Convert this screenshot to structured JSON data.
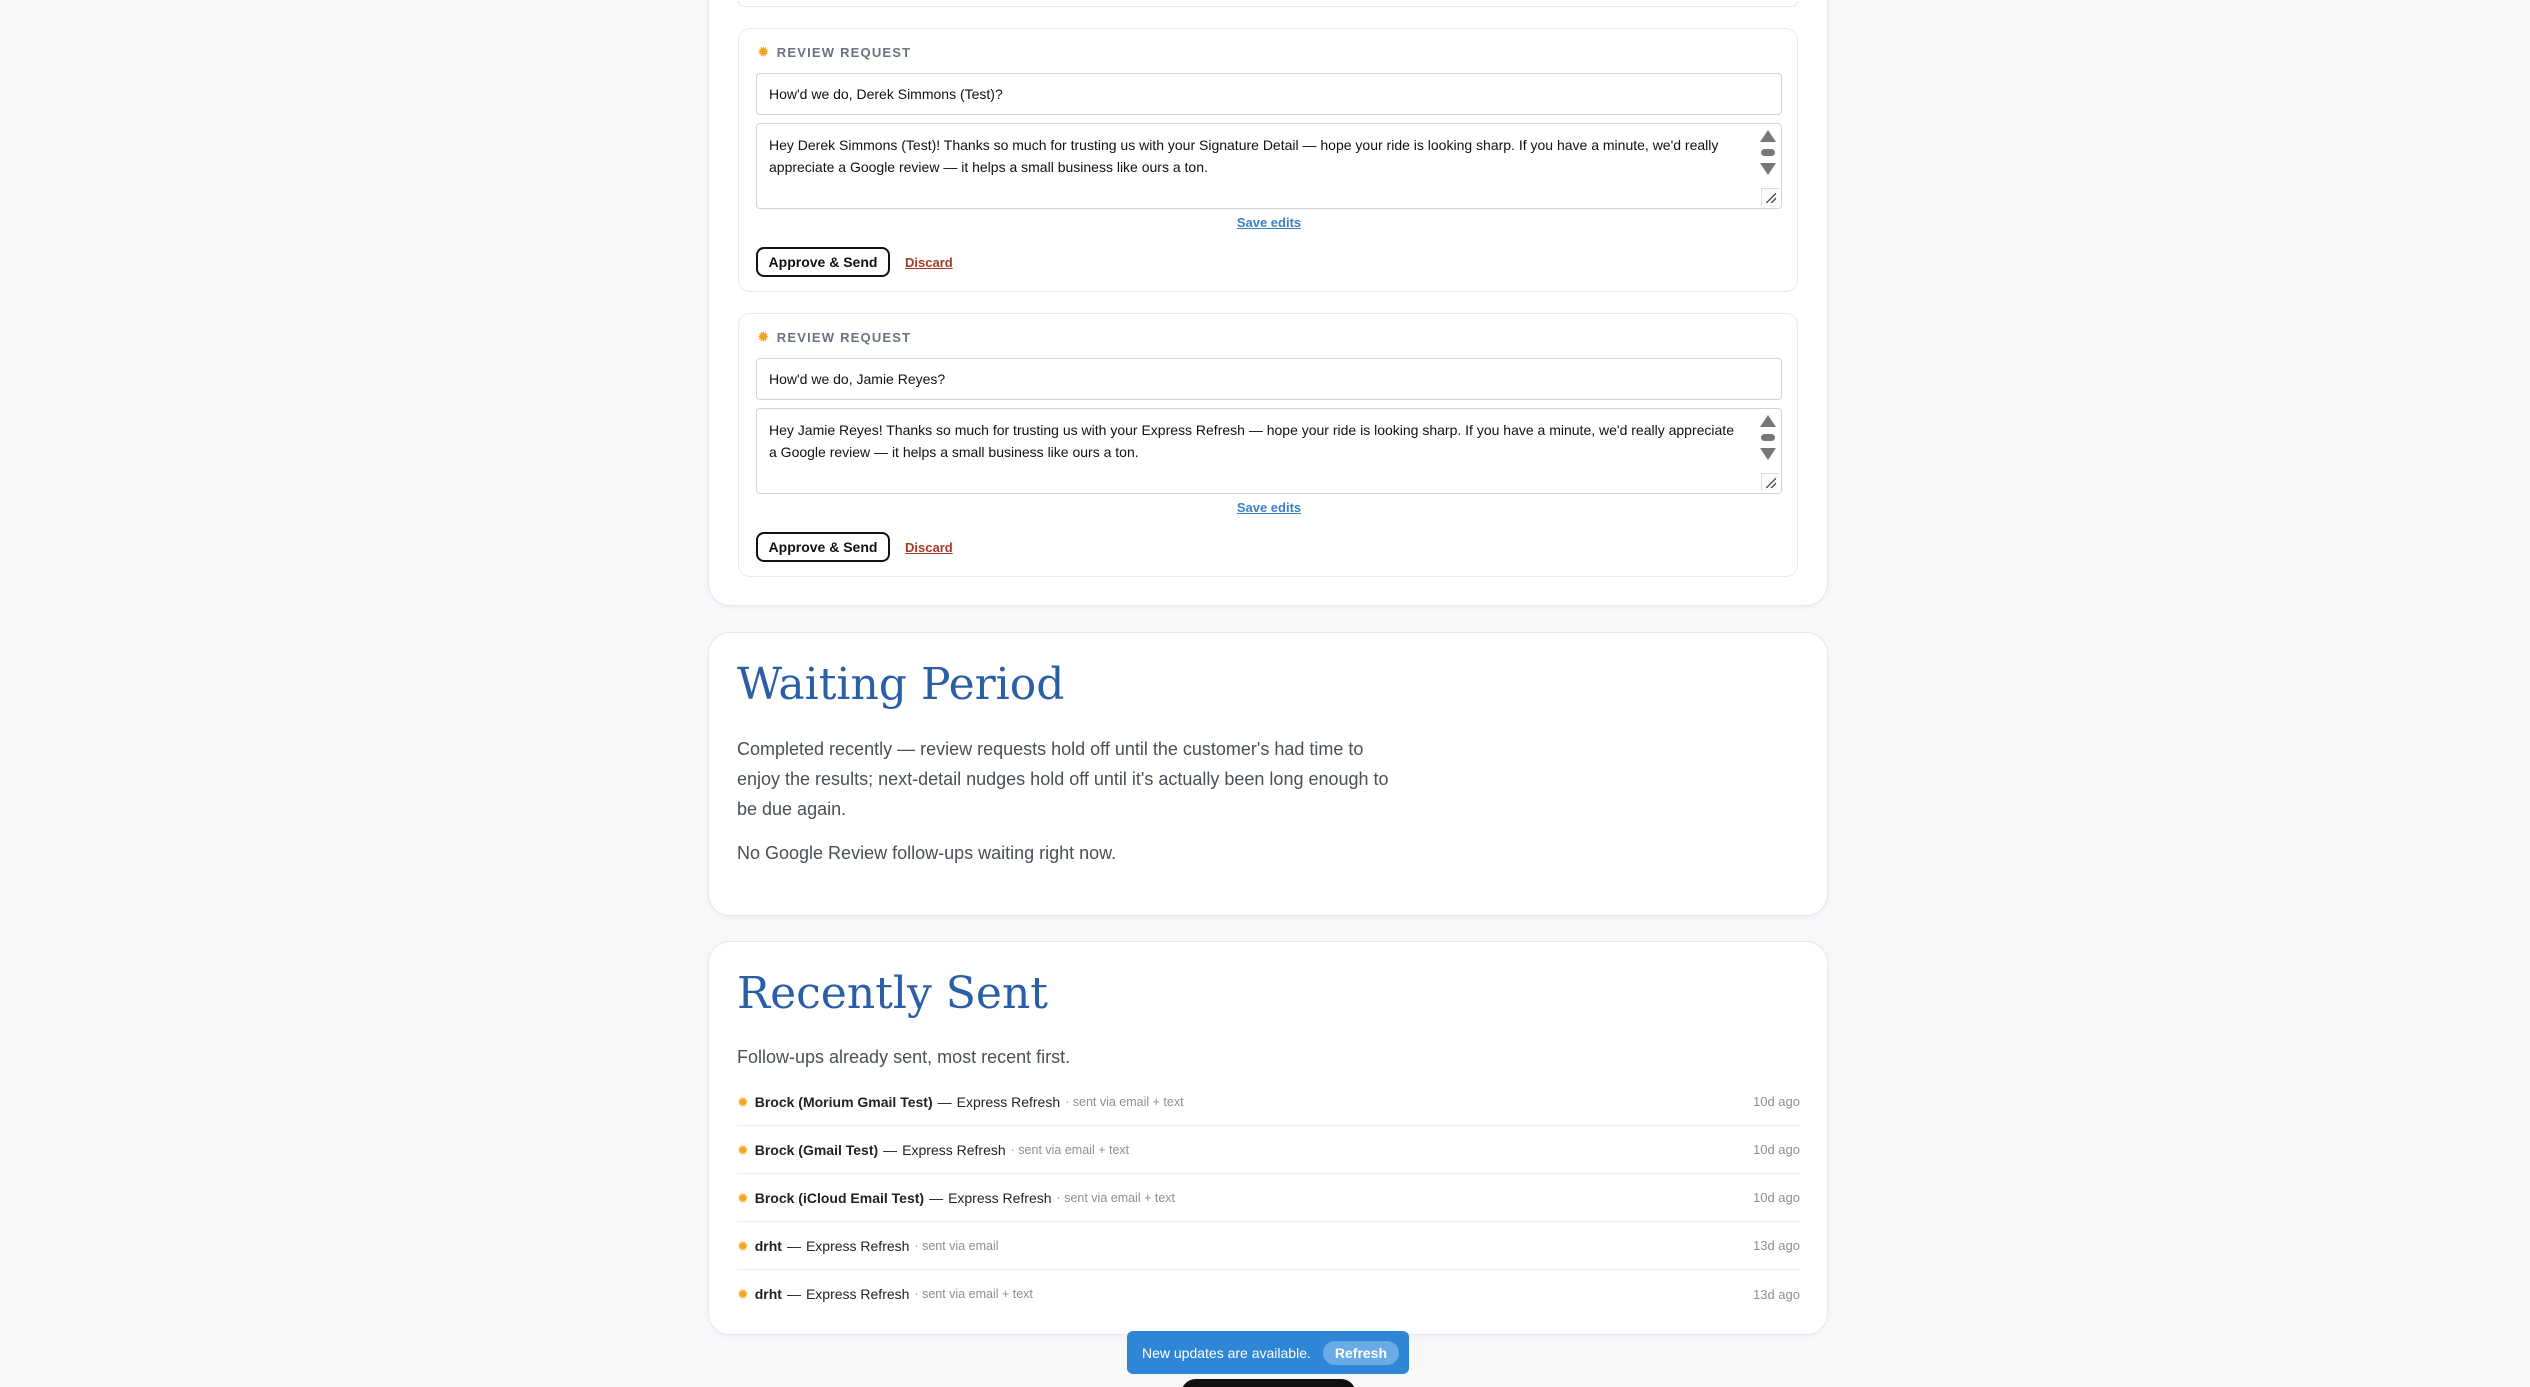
{
  "review_queue": {
    "requests": [
      {
        "type_label": "REVIEW REQUEST",
        "subject": "How'd we do, Derek Simmons (Test)?",
        "body": "Hey Derek Simmons (Test)! Thanks so much for trusting us with your Signature Detail — hope your ride is looking sharp. If you have a minute, we'd really appreciate a Google review — it helps a small business like ours a ton.",
        "save_label": "Save edits",
        "approve_label": "Approve & Send",
        "discard_label": "Discard"
      },
      {
        "type_label": "REVIEW REQUEST",
        "subject": "How'd we do, Jamie Reyes?",
        "body": "Hey Jamie Reyes! Thanks so much for trusting us with your Express Refresh — hope your ride is looking sharp. If you have a minute, we'd really appreciate a Google review — it helps a small business like ours a ton.",
        "save_label": "Save edits",
        "approve_label": "Approve & Send",
        "discard_label": "Discard"
      }
    ]
  },
  "waiting_period": {
    "title": "Waiting Period",
    "description": "Completed recently — review requests hold off until the customer's had time to enjoy the results; next-detail nudges hold off until it's actually been long enough to be due again.",
    "empty_message": "No Google Review follow-ups waiting right now."
  },
  "recently_sent": {
    "title": "Recently Sent",
    "description": "Follow-ups already sent, most recent first.",
    "items": [
      {
        "name": "Brock (Morium Gmail Test)",
        "service": "Express Refresh",
        "via": "sent via email + text",
        "ago": "10d ago"
      },
      {
        "name": "Brock (Gmail Test)",
        "service": "Express Refresh",
        "via": "sent via email + text",
        "ago": "10d ago"
      },
      {
        "name": "Brock (iCloud Email Test)",
        "service": "Express Refresh",
        "via": "sent via email + text",
        "ago": "10d ago"
      },
      {
        "name": "drht",
        "service": "Express Refresh",
        "via": "sent via email",
        "ago": "13d ago"
      },
      {
        "name": "drht",
        "service": "Express Refresh",
        "via": "sent via email + text",
        "ago": "13d ago"
      }
    ]
  },
  "toast": {
    "message": "New updates are available.",
    "button_label": "Refresh"
  },
  "colors": {
    "accent_title": "#2a5ea7",
    "link": "#3b82c4",
    "discard": "#a33a2a",
    "star": "#f0a520",
    "toast_bg": "#2f86d6"
  },
  "icons": {
    "review_type": "sun-star-icon",
    "sent_item": "sun-star-icon"
  }
}
